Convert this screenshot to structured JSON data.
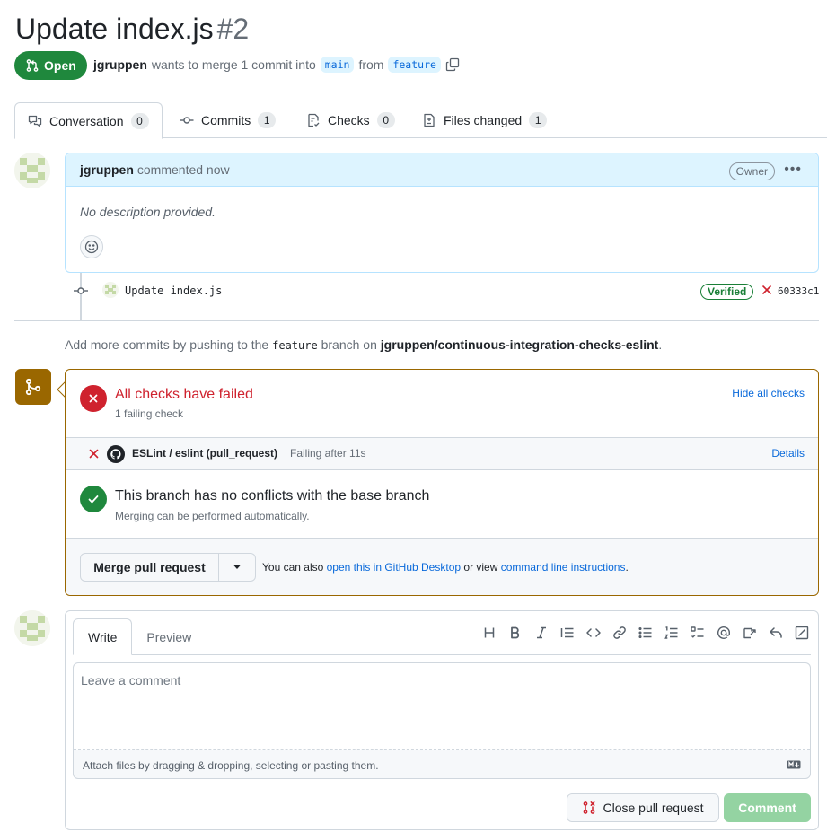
{
  "pr": {
    "title": "Update index.js",
    "number": "#2",
    "state": "Open",
    "author": "jgruppen",
    "merge_text": "wants to merge 1 commit into",
    "base_branch": "main",
    "from_text": "from",
    "head_branch": "feature"
  },
  "tabs": [
    {
      "label": "Conversation",
      "count": "0"
    },
    {
      "label": "Commits",
      "count": "1"
    },
    {
      "label": "Checks",
      "count": "0"
    },
    {
      "label": "Files changed",
      "count": "1"
    }
  ],
  "comment": {
    "author": "jgruppen",
    "action": "commented now",
    "role": "Owner",
    "body": "No description provided."
  },
  "commit": {
    "message": "Update index.js",
    "verified": "Verified",
    "sha": "60333c1"
  },
  "push_hint": {
    "prefix": "Add more commits by pushing to the",
    "branch": "feature",
    "middle": "branch on",
    "repo": "jgruppen/continuous-integration-checks-eslint",
    "suffix": "."
  },
  "checks": {
    "title": "All checks have failed",
    "subtitle": "1 failing check",
    "hide_link": "Hide all checks",
    "item_name": "ESLint / eslint (pull_request)",
    "item_status": "Failing after 11s",
    "item_details": "Details"
  },
  "conflicts": {
    "title": "This branch has no conflicts with the base branch",
    "subtitle": "Merging can be performed automatically."
  },
  "merge": {
    "button": "Merge pull request",
    "alt_prefix": "You can also",
    "alt_link1": "open this in GitHub Desktop",
    "alt_middle": "or view",
    "alt_link2": "command line instructions",
    "alt_suffix": "."
  },
  "editor": {
    "tab_write": "Write",
    "tab_preview": "Preview",
    "placeholder": "Leave a comment",
    "attach_hint": "Attach files by dragging & dropping, selecting or pasting them.",
    "close_button": "Close pull request",
    "comment_button": "Comment"
  },
  "colors": {
    "open_green": "#1f883d",
    "danger": "#cf222e",
    "success": "#1a7f37",
    "warning": "#9a6700",
    "link": "#0969da"
  }
}
